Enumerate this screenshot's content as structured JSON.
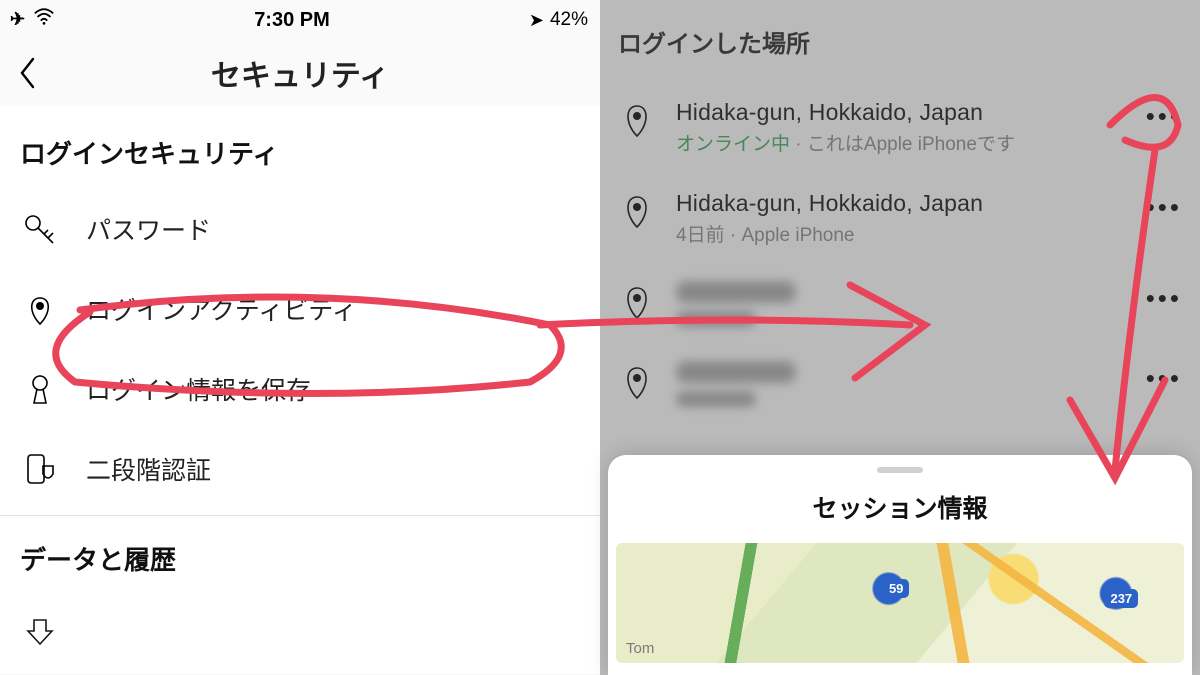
{
  "status_bar": {
    "time": "7:30 PM",
    "battery": "42%"
  },
  "left": {
    "header_title": "セキュリティ",
    "section1_title": "ログインセキュリティ",
    "menu": {
      "password": "パスワード",
      "login_activity": "ログインアクティビティ",
      "save_login": "ログイン情報を保存",
      "two_factor": "二段階認証"
    },
    "section2_title": "データと履歴"
  },
  "right": {
    "title": "ログインした場所",
    "entries": [
      {
        "location": "Hidaka-gun, Hokkaido, Japan",
        "status_online": "オンライン中",
        "status_sep": " · ",
        "status_device": "これはApple iPhoneです"
      },
      {
        "location": "Hidaka-gun, Hokkaido, Japan",
        "status_time": "4日前",
        "status_sep": " · ",
        "status_device": "Apple iPhone"
      }
    ],
    "sheet_title": "セッション情報",
    "map": {
      "city_label": "Tom",
      "route1": "59",
      "route2": "237"
    }
  }
}
